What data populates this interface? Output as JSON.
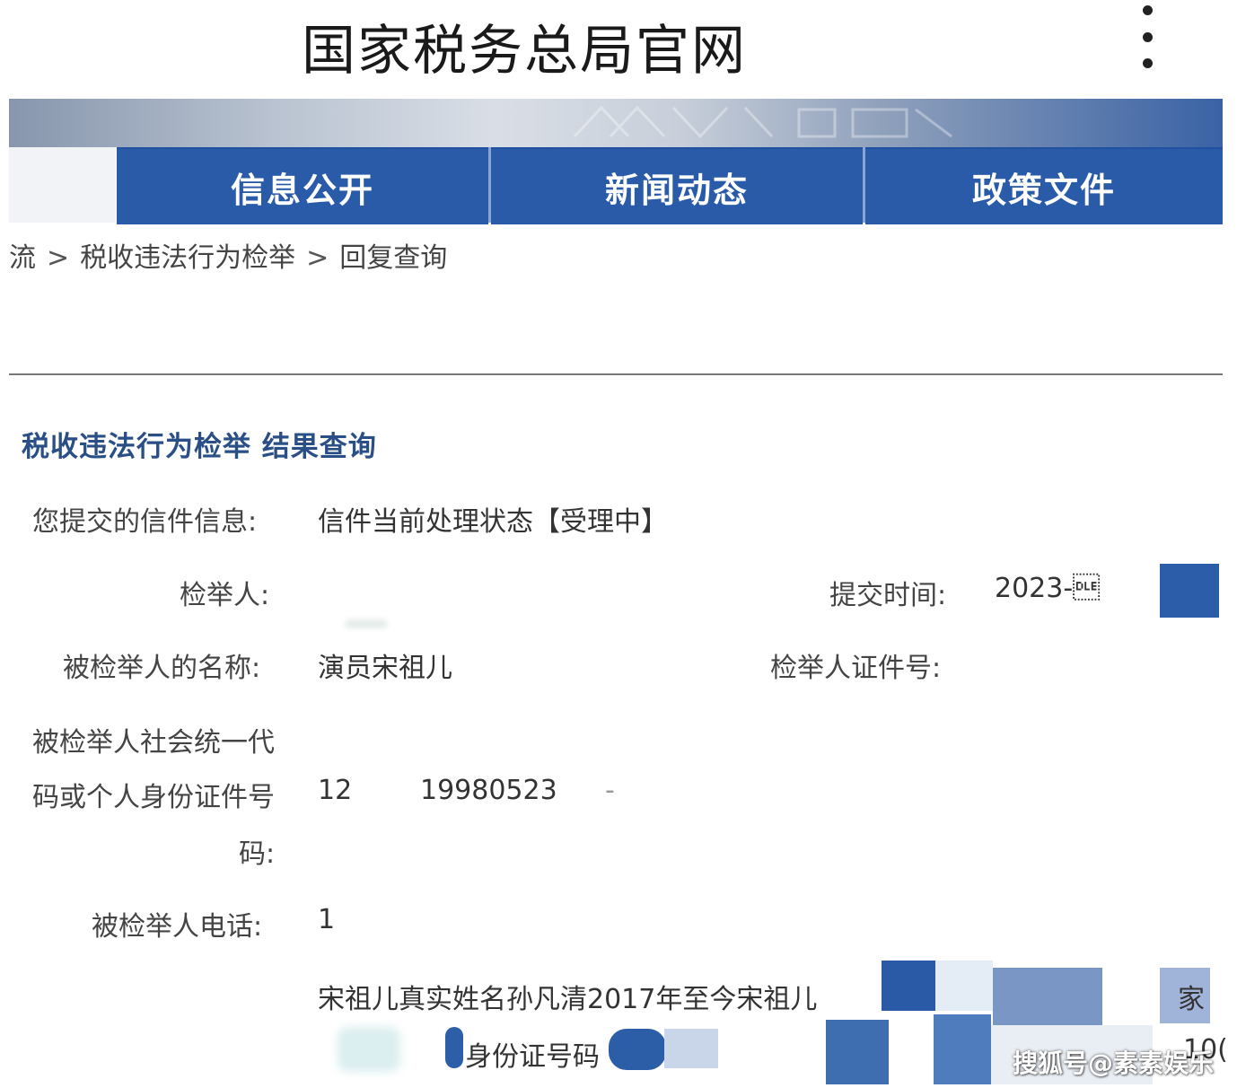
{
  "header": {
    "site_title": "国家税务总局官网",
    "menu_icon": "more-vertical-icon"
  },
  "nav": {
    "tabs": [
      {
        "label": "信息公开"
      },
      {
        "label": "新闻动态"
      },
      {
        "label": "政策文件"
      }
    ]
  },
  "breadcrumb": {
    "items": [
      "流",
      "税收违法行为检举",
      "回复查询"
    ],
    "separator": ">"
  },
  "result": {
    "title": "税收违法行为检举 结果查询",
    "letter_info_label": "您提交的信件信息:",
    "letter_status": "信件当前处理状态【受理中】",
    "reporter_label": "检举人:",
    "submit_time_label": "提交时间:",
    "submit_time_value": "2023-\u0010",
    "reported_name_label": "被检举人的名称:",
    "reported_name_value": "演员宋祖儿",
    "reporter_id_label": "检举人证件号:",
    "reported_code_label_line1": "被检举人社会统一代",
    "reported_code_label_line2": "码或个人身份证件号",
    "reported_code_label_line3": "码:",
    "reported_code_value_prefix": "12",
    "reported_code_value_mid": "19980523",
    "reported_code_value_tail": "-",
    "reported_phone_label": "被检举人电话:",
    "reported_phone_value": "1",
    "content_line1": "宋祖儿真实姓名孙凡清2017年至今宋祖儿",
    "content_line1_tail": "家",
    "content_line2": "身份证号码",
    "content_line2_tail": "10("
  },
  "watermark": "搜狐号@素素娱乐",
  "colors": {
    "nav_blue": "#2a5ba8",
    "title_blue": "#2a4f86"
  }
}
